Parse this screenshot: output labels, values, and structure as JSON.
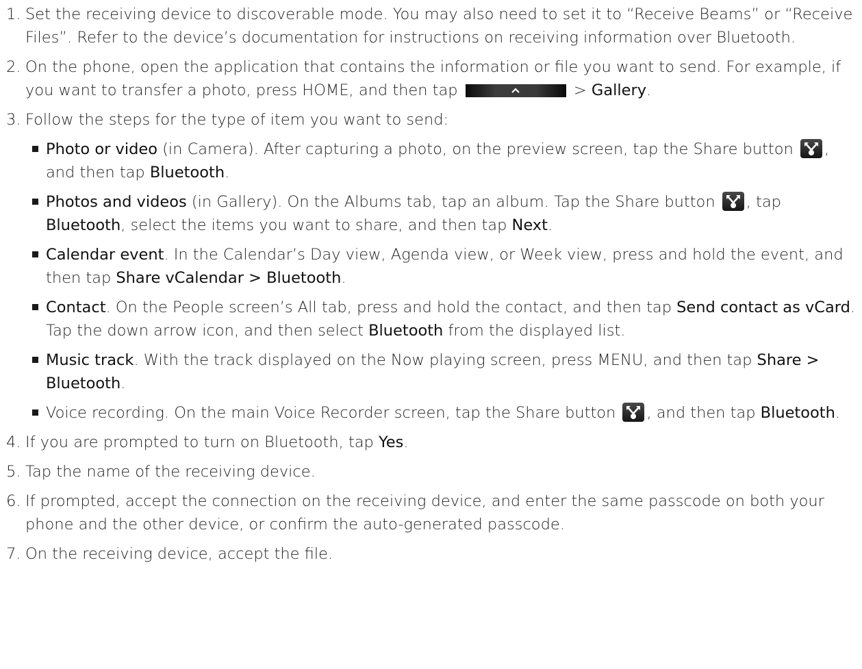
{
  "steps": [
    {
      "num": "1.",
      "t1": "Set the receiving device to discoverable mode. You may also need to set it to “Receive Beams” or “Receive Files”. Refer to the device’s documentation for instructions on receiving information over Bluetooth."
    },
    {
      "num": "2.",
      "t1": "On the phone, open the application that contains the information or file you want to send. For example, if you want to transfer a photo, press HOME, and then tap",
      "t2": " > ",
      "b1": "Gallery",
      "t3": "."
    },
    {
      "num": "3.",
      "t1": "Follow the steps for the type of item you want to send:"
    },
    {
      "num": "4.",
      "t1": "If you are prompted to turn on Bluetooth, tap ",
      "b1": "Yes",
      "t2": "."
    },
    {
      "num": "5.",
      "t1": "Tap the name of the receiving device."
    },
    {
      "num": "6.",
      "t1": "If prompted, accept the connection on the receiving device, and enter the same passcode on both your phone and the other device, or confirm the auto-generated passcode."
    },
    {
      "num": "7.",
      "t1": "On the receiving device, accept the file."
    }
  ],
  "bullets": [
    {
      "b1": "Photo or video",
      "t1": " (in Camera). After capturing a photo, on the preview screen, tap the Share button ",
      "t2": ", and then tap ",
      "b2": "Bluetooth",
      "t3": "."
    },
    {
      "b1": "Photos and videos",
      "t1": " (in Gallery). On the Albums tab, tap an album. Tap the Share button ",
      "t2": ", tap ",
      "b2": "Bluetooth",
      "t3": ", select the items you want to share, and then tap ",
      "b3": "Next",
      "t4": "."
    },
    {
      "b1": "Calendar event",
      "t1": ". In the Calendar’s Day view, Agenda view, or Week view, press and hold the event, and then tap ",
      "b2": "Share vCalendar > Bluetooth",
      "t2": "."
    },
    {
      "b1": "Contact",
      "t1": ". On the People screen’s All tab, press and hold the contact, and then tap ",
      "b2": "Send contact as vCard",
      "t2": ". Tap the down arrow icon, and then select ",
      "b3": "Bluetooth",
      "t3": " from the displayed list."
    },
    {
      "b1": "Music track",
      "t1": ". With the track displayed on the Now playing screen, press MENU, and then tap ",
      "b2": "Share > Bluetooth",
      "t2": "."
    },
    {
      "t0": "Voice recording. On the main Voice Recorder screen, tap the Share button ",
      "t1": ", and then tap ",
      "b1": "Bluetooth",
      "t2": "."
    }
  ],
  "icons": {
    "all_apps_bar": "up-arrow-bar-icon",
    "share": "share-icon"
  }
}
